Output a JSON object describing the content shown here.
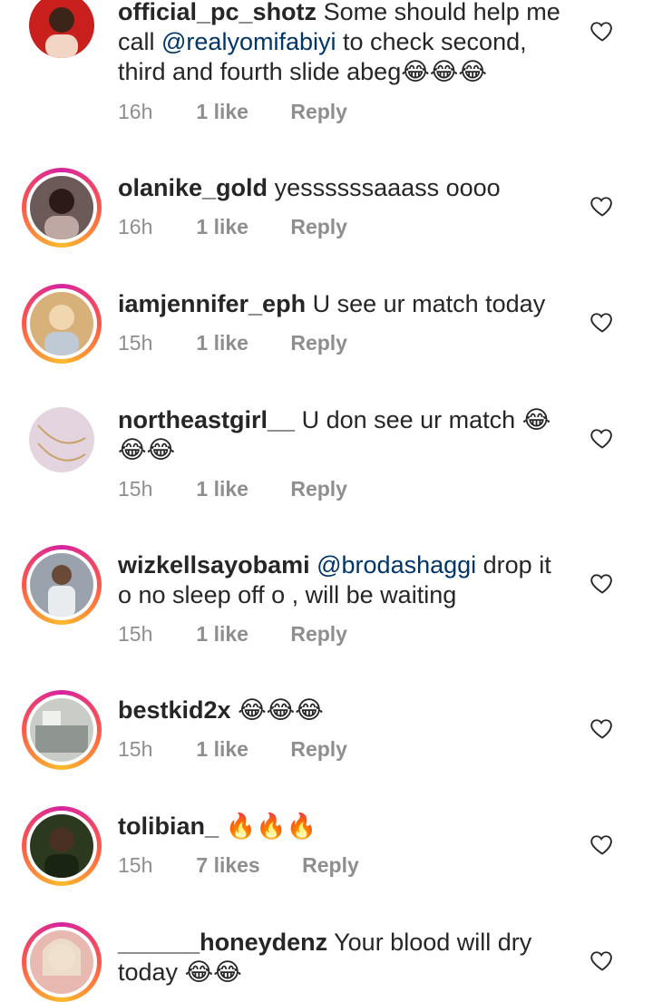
{
  "comments": [
    {
      "username": "official_pc_shotz",
      "text_parts": [
        "Some should help me call ",
        "@realyomifabiyi",
        " to check second, third and fourth slide abeg"
      ],
      "emoji": "😂😂😂",
      "time": "16h",
      "likes": "1 like",
      "reply": "Reply",
      "avatar_color": "#c9201e"
    },
    {
      "username": "olanike_gold",
      "text": "yessssssaaass oooo",
      "time": "16h",
      "likes": "1 like",
      "reply": "Reply",
      "avatar_color": "#6b5a58"
    },
    {
      "username": "iamjennifer_eph",
      "text": "U see ur match today",
      "time": "15h",
      "likes": "1 like",
      "reply": "Reply",
      "avatar_color": "#d7b07a"
    },
    {
      "username": "northeastgirl__",
      "text": "U don see ur match",
      "emoji": "😂😂😂",
      "time": "15h",
      "likes": "1 like",
      "reply": "Reply",
      "avatar_color": "#e3d4df"
    },
    {
      "username": "wizkellsayobami",
      "text_parts": [
        "",
        "@brodashaggi",
        " drop it o no sleep off o , will be waiting"
      ],
      "time": "15h",
      "likes": "1 like",
      "reply": "Reply",
      "avatar_color": "#9aa2ad"
    },
    {
      "username": "bestkid2x",
      "emoji": "😂😂😂",
      "time": "15h",
      "likes": "1 like",
      "reply": "Reply",
      "avatar_color": "#c9ccc7"
    },
    {
      "username": "tolibian_",
      "emoji": "🔥🔥🔥",
      "time": "15h",
      "likes": "7 likes",
      "reply": "Reply",
      "avatar_color": "#2b3a1f"
    },
    {
      "username": "______honeydenz",
      "text": "Your blood will dry today",
      "emoji": "😂😂",
      "avatar_color": "#e7b9b0"
    }
  ],
  "icons": {
    "like": "heart-outline-icon"
  },
  "colors": {
    "mention": "#003569",
    "meta": "#8e8e8e",
    "text": "#262626"
  }
}
